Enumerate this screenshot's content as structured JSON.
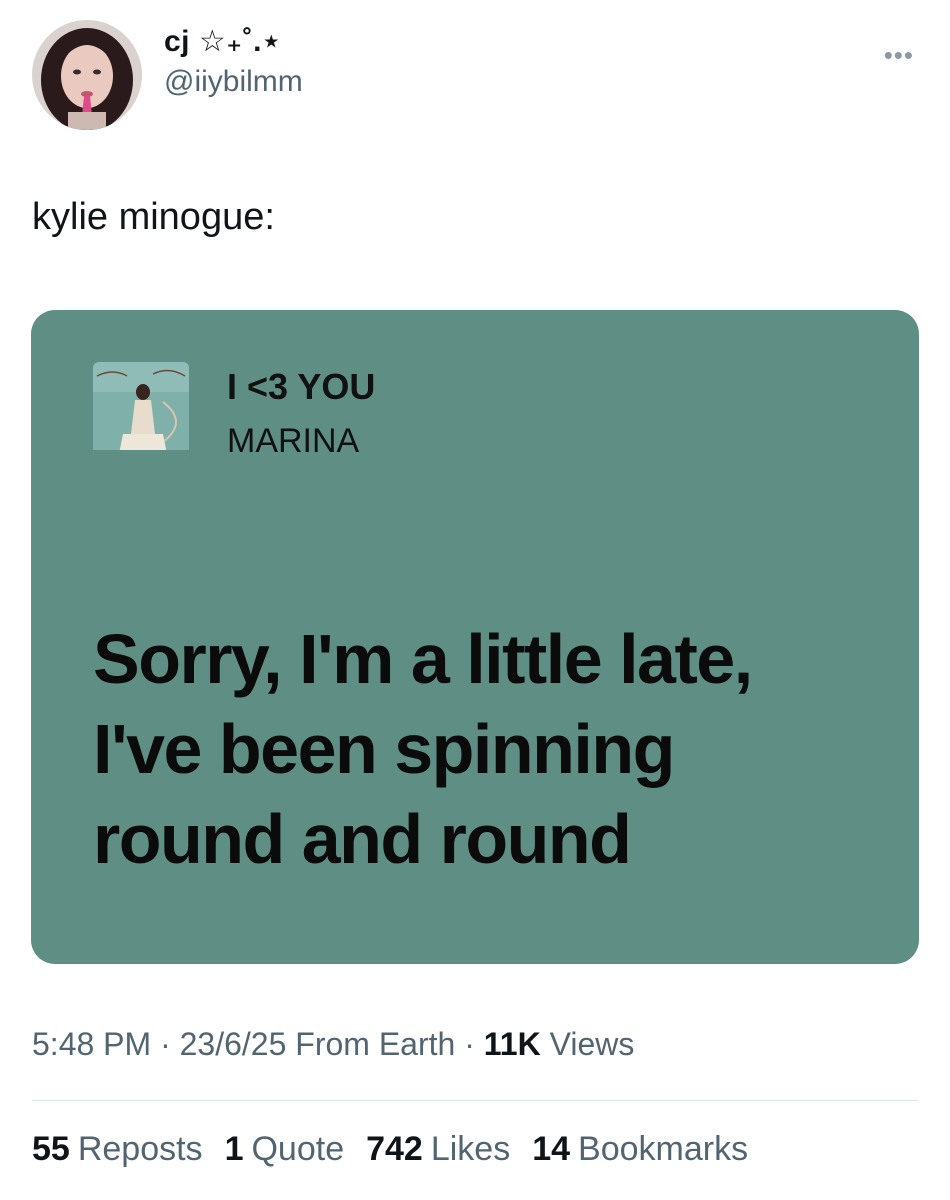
{
  "author": {
    "display_name": "cj ☆₊˚.⋆",
    "handle": "@iiybilmm"
  },
  "more_label": "•••",
  "tweet_text": "kylie minogue:",
  "lyric_card": {
    "song_title": "I <3 YOU",
    "artist": "MARINA",
    "lyrics": [
      "Sorry, I'm a little late,",
      "I've been spinning",
      "round and round"
    ],
    "background_color": "#5f8f84"
  },
  "meta": {
    "time": "5:48 PM",
    "separator": "·",
    "date": "23/6/25",
    "location": "From Earth",
    "views_count": "11K",
    "views_label": "Views"
  },
  "stats": [
    {
      "count": "55",
      "label": "Reposts"
    },
    {
      "count": "1",
      "label": "Quote"
    },
    {
      "count": "742",
      "label": "Likes"
    },
    {
      "count": "14",
      "label": "Bookmarks"
    }
  ]
}
